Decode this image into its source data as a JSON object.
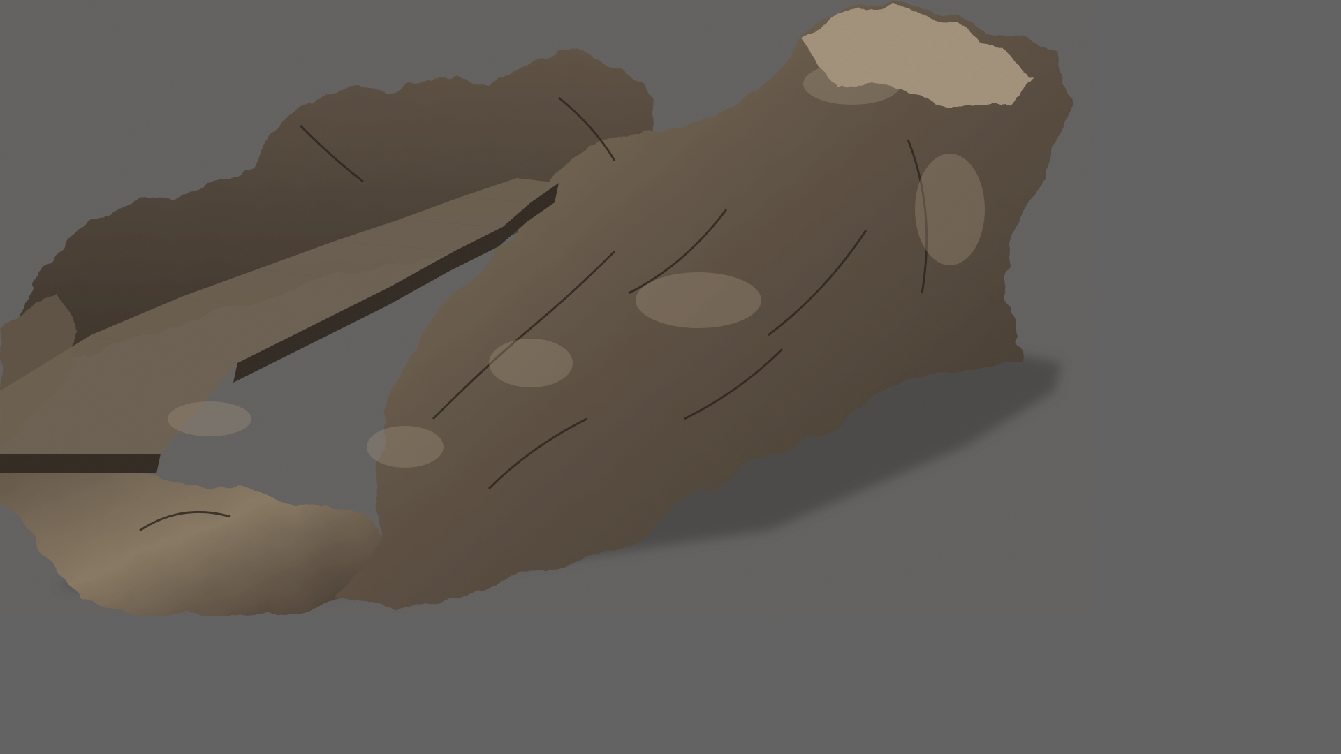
{
  "colors": {
    "background": "#636363",
    "shadow": "#4a4a4a",
    "rock_dark": "#3a3129",
    "rock_mid": "#5e5244",
    "rock_light": "#8c7c66",
    "rock_highlight": "#a89780",
    "step_top": "#6e6252",
    "step_riser": "#2f2821",
    "crack": "#241e18"
  }
}
